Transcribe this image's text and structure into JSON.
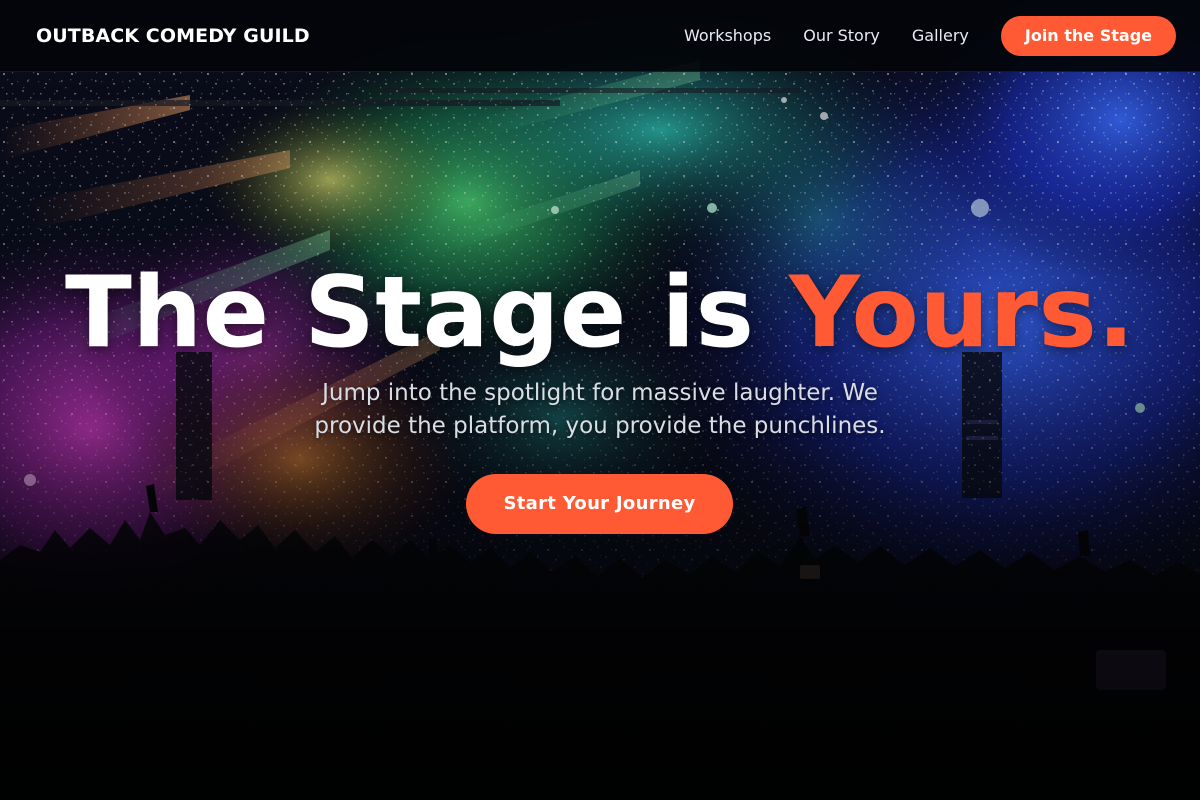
{
  "header": {
    "brand": "OUTBACK COMEDY GUILD",
    "nav": [
      "Workshops",
      "Our Story",
      "Gallery"
    ],
    "cta_label": "Join the Stage"
  },
  "hero": {
    "title_main": "The Stage is ",
    "title_accent": "Yours.",
    "subtitle": "Jump into the spotlight for massive laughter. We provide the platform, you provide the punchlines.",
    "cta_label": "Start Your Journey"
  },
  "colors": {
    "accent": "#ff5a33",
    "header_bg": "#03050a",
    "text_light": "#ffffff"
  },
  "icons": []
}
